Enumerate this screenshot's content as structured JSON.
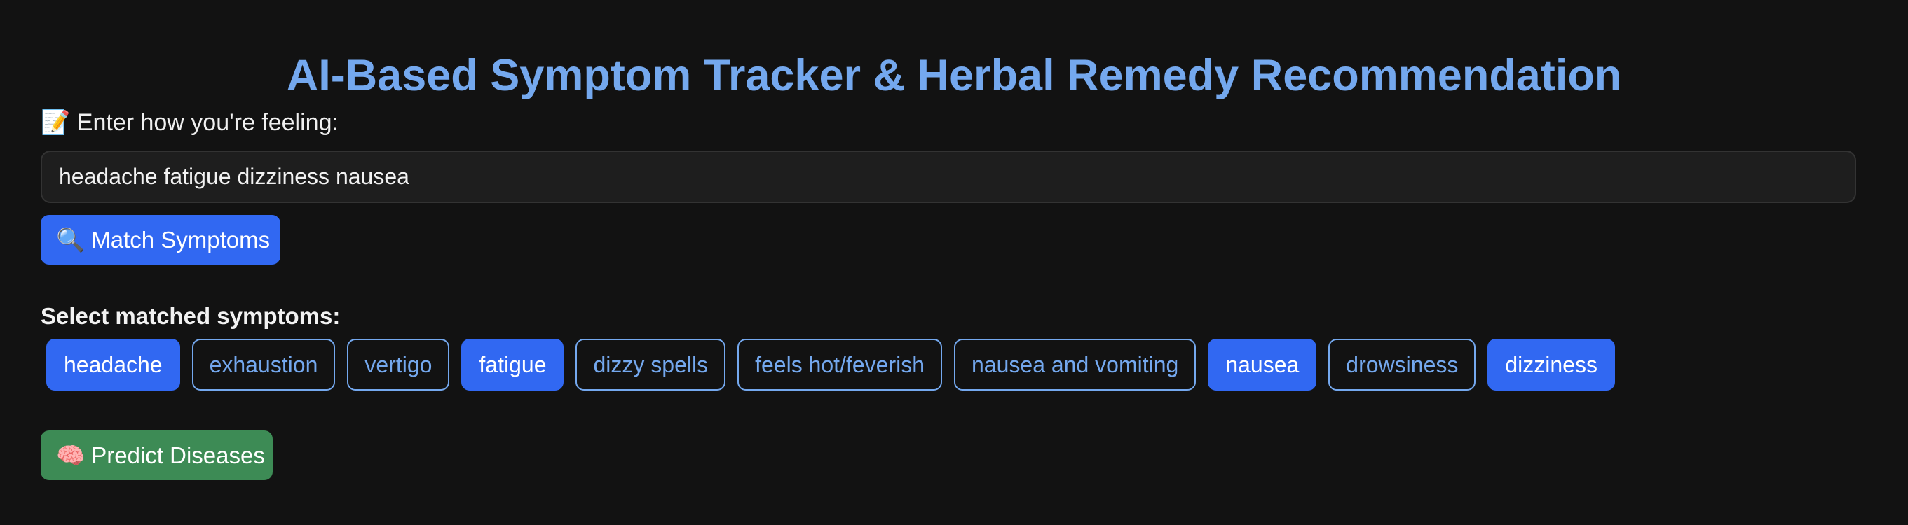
{
  "colors": {
    "background": "#121212",
    "title": "#74a8ee",
    "primary_button": "#3168f2",
    "predict_button": "#3d8b55",
    "chip_selected_bg": "#3168f2",
    "chip_unselected_border": "#74a8ee"
  },
  "header": {
    "title": "AI-Based Symptom Tracker & Herbal Remedy Recommendation"
  },
  "input_section": {
    "label_icon": "memo-icon",
    "label": "📝 Enter how you're feeling:",
    "value": "headache fatigue dizziness nausea",
    "placeholder": ""
  },
  "match_button": {
    "icon": "magnifier-icon",
    "label": "🔍 Match Symptoms"
  },
  "symptoms_section": {
    "label": "Select matched symptoms:",
    "chips": [
      {
        "label": "headache",
        "selected": true
      },
      {
        "label": "exhaustion",
        "selected": false
      },
      {
        "label": "vertigo",
        "selected": false
      },
      {
        "label": "fatigue",
        "selected": true
      },
      {
        "label": "dizzy spells",
        "selected": false
      },
      {
        "label": "feels hot/feverish",
        "selected": false
      },
      {
        "label": "nausea and vomiting",
        "selected": false
      },
      {
        "label": "nausea",
        "selected": true
      },
      {
        "label": "drowsiness",
        "selected": false
      },
      {
        "label": "dizziness",
        "selected": true
      }
    ]
  },
  "predict_button": {
    "icon": "brain-icon",
    "label": "🧠 Predict Diseases"
  }
}
